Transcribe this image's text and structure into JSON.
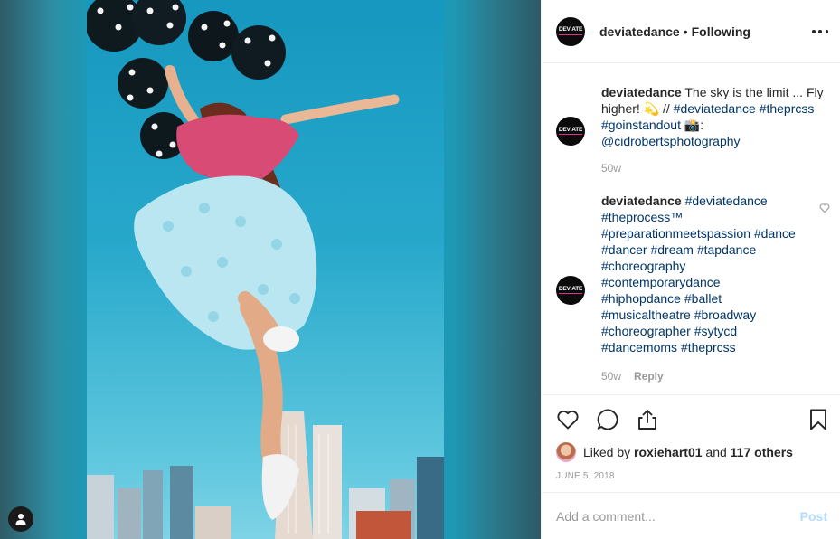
{
  "post": {
    "username": "deviatedance",
    "separator": "•",
    "follow_state": "Following",
    "avatar_text": "DEVIATE"
  },
  "comments": [
    {
      "username": "deviatedance",
      "text_parts": [
        "The sky is the limit ... Fly higher! 💫 // ",
        "#deviatedance",
        " ",
        "#theprcss",
        " ",
        "#goinstandout",
        " 📸: ",
        "@cidrobertsphotography"
      ],
      "age": "50w"
    },
    {
      "username": "deviatedance",
      "tags": [
        "#deviatedance",
        "#theprocess™",
        "#preparationmeetspassion",
        "#dance",
        "#dancer",
        "#dream",
        "#tapdance",
        "#choreography",
        "#contemporarydance",
        "#hiphopdance",
        "#ballet",
        "#musicaltheatre",
        "#broadway",
        "#choreographer",
        "#sytycd",
        "#dancemoms",
        "#theprcss"
      ],
      "age": "50w",
      "reply_label": "Reply"
    }
  ],
  "likes": {
    "prefix": "Liked by ",
    "user": "roxiehart01",
    "joiner": " and ",
    "others": "117 others"
  },
  "date": "JUNE 5, 2018",
  "composer": {
    "placeholder": "Add a comment...",
    "post_label": "Post"
  },
  "icons": {
    "like": "heart-icon",
    "comment": "speech-bubble-icon",
    "share": "share-icon",
    "save": "bookmark-icon",
    "more": "more-dots-icon",
    "user_tag": "person-icon"
  },
  "colors": {
    "hashtag": "#003569",
    "muted": "#999999",
    "post_disabled": "#b3dbff",
    "sky": "#1d98b5"
  }
}
